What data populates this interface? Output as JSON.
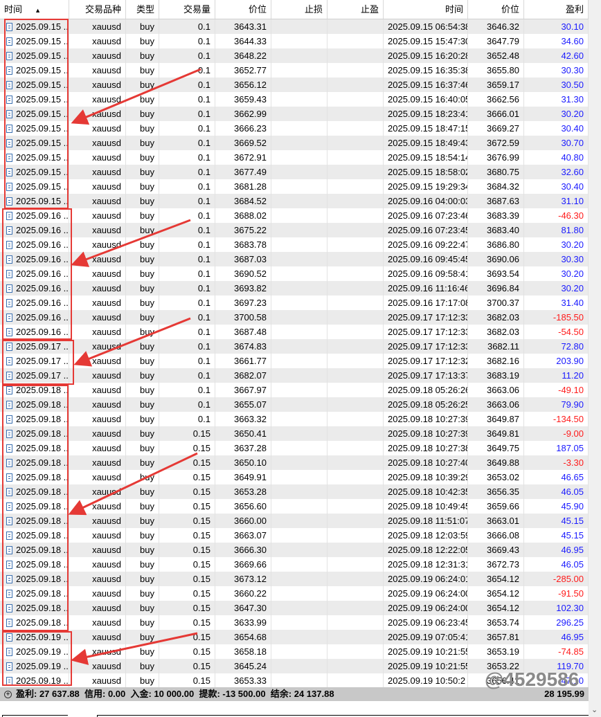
{
  "columns": [
    "时间",
    "交易品种",
    "类型",
    "交易量",
    "价位",
    "止损",
    "止盈",
    "时间",
    "价位",
    "盈利"
  ],
  "sort_indicator": "▲",
  "rows": [
    [
      "2025.09.15 ...",
      "xauusd",
      "buy",
      "0.1",
      "3643.31",
      "",
      "",
      "2025.09.15 06:54:38",
      "3646.32",
      "30.10"
    ],
    [
      "2025.09.15 ...",
      "xauusd",
      "buy",
      "0.1",
      "3644.33",
      "",
      "",
      "2025.09.15 15:47:30",
      "3647.79",
      "34.60"
    ],
    [
      "2025.09.15 ...",
      "xauusd",
      "buy",
      "0.1",
      "3648.22",
      "",
      "",
      "2025.09.15 16:20:28",
      "3652.48",
      "42.60"
    ],
    [
      "2025.09.15 ...",
      "xauusd",
      "buy",
      "0.1",
      "3652.77",
      "",
      "",
      "2025.09.15 16:35:38",
      "3655.80",
      "30.30"
    ],
    [
      "2025.09.15 ...",
      "xauusd",
      "buy",
      "0.1",
      "3656.12",
      "",
      "",
      "2025.09.15 16:37:46",
      "3659.17",
      "30.50"
    ],
    [
      "2025.09.15 ...",
      "xauusd",
      "buy",
      "0.1",
      "3659.43",
      "",
      "",
      "2025.09.15 16:40:05",
      "3662.56",
      "31.30"
    ],
    [
      "2025.09.15 ...",
      "xauusd",
      "buy",
      "0.1",
      "3662.99",
      "",
      "",
      "2025.09.15 18:23:41",
      "3666.01",
      "30.20"
    ],
    [
      "2025.09.15 ...",
      "xauusd",
      "buy",
      "0.1",
      "3666.23",
      "",
      "",
      "2025.09.15 18:47:15",
      "3669.27",
      "30.40"
    ],
    [
      "2025.09.15 ...",
      "xauusd",
      "buy",
      "0.1",
      "3669.52",
      "",
      "",
      "2025.09.15 18:49:43",
      "3672.59",
      "30.70"
    ],
    [
      "2025.09.15 ...",
      "xauusd",
      "buy",
      "0.1",
      "3672.91",
      "",
      "",
      "2025.09.15 18:54:14",
      "3676.99",
      "40.80"
    ],
    [
      "2025.09.15 ...",
      "xauusd",
      "buy",
      "0.1",
      "3677.49",
      "",
      "",
      "2025.09.15 18:58:02",
      "3680.75",
      "32.60"
    ],
    [
      "2025.09.15 ...",
      "xauusd",
      "buy",
      "0.1",
      "3681.28",
      "",
      "",
      "2025.09.15 19:29:34",
      "3684.32",
      "30.40"
    ],
    [
      "2025.09.15 ...",
      "xauusd",
      "buy",
      "0.1",
      "3684.52",
      "",
      "",
      "2025.09.16 04:00:03",
      "3687.63",
      "31.10"
    ],
    [
      "2025.09.16 ...",
      "xauusd",
      "buy",
      "0.1",
      "3688.02",
      "",
      "",
      "2025.09.16 07:23:46",
      "3683.39",
      "-46.30"
    ],
    [
      "2025.09.16 ...",
      "xauusd",
      "buy",
      "0.1",
      "3675.22",
      "",
      "",
      "2025.09.16 07:23:45",
      "3683.40",
      "81.80"
    ],
    [
      "2025.09.16 ...",
      "xauusd",
      "buy",
      "0.1",
      "3683.78",
      "",
      "",
      "2025.09.16 09:22:47",
      "3686.80",
      "30.20"
    ],
    [
      "2025.09.16 ...",
      "xauusd",
      "buy",
      "0.1",
      "3687.03",
      "",
      "",
      "2025.09.16 09:45:45",
      "3690.06",
      "30.30"
    ],
    [
      "2025.09.16 ...",
      "xauusd",
      "buy",
      "0.1",
      "3690.52",
      "",
      "",
      "2025.09.16 09:58:41",
      "3693.54",
      "30.20"
    ],
    [
      "2025.09.16 ...",
      "xauusd",
      "buy",
      "0.1",
      "3693.82",
      "",
      "",
      "2025.09.16 11:16:46",
      "3696.84",
      "30.20"
    ],
    [
      "2025.09.16 ...",
      "xauusd",
      "buy",
      "0.1",
      "3697.23",
      "",
      "",
      "2025.09.16 17:17:08",
      "3700.37",
      "31.40"
    ],
    [
      "2025.09.16 ...",
      "xauusd",
      "buy",
      "0.1",
      "3700.58",
      "",
      "",
      "2025.09.17 17:12:33",
      "3682.03",
      "-185.50"
    ],
    [
      "2025.09.16 ...",
      "xauusd",
      "buy",
      "0.1",
      "3687.48",
      "",
      "",
      "2025.09.17 17:12:33",
      "3682.03",
      "-54.50"
    ],
    [
      "2025.09.17 ...",
      "xauusd",
      "buy",
      "0.1",
      "3674.83",
      "",
      "",
      "2025.09.17 17:12:33",
      "3682.11",
      "72.80"
    ],
    [
      "2025.09.17 ...",
      "xauusd",
      "buy",
      "0.1",
      "3661.77",
      "",
      "",
      "2025.09.17 17:12:32",
      "3682.16",
      "203.90"
    ],
    [
      "2025.09.17 ...",
      "xauusd",
      "buy",
      "0.1",
      "3682.07",
      "",
      "",
      "2025.09.17 17:13:37",
      "3683.19",
      "11.20"
    ],
    [
      "2025.09.18 ...",
      "xauusd",
      "buy",
      "0.1",
      "3667.97",
      "",
      "",
      "2025.09.18 05:26:26",
      "3663.06",
      "-49.10"
    ],
    [
      "2025.09.18 ...",
      "xauusd",
      "buy",
      "0.1",
      "3655.07",
      "",
      "",
      "2025.09.18 05:26:25",
      "3663.06",
      "79.90"
    ],
    [
      "2025.09.18 ...",
      "xauusd",
      "buy",
      "0.1",
      "3663.32",
      "",
      "",
      "2025.09.18 10:27:39",
      "3649.87",
      "-134.50"
    ],
    [
      "2025.09.18 ...",
      "xauusd",
      "buy",
      "0.15",
      "3650.41",
      "",
      "",
      "2025.09.18 10:27:39",
      "3649.81",
      "-9.00"
    ],
    [
      "2025.09.18 ...",
      "xauusd",
      "buy",
      "0.15",
      "3637.28",
      "",
      "",
      "2025.09.18 10:27:38",
      "3649.75",
      "187.05"
    ],
    [
      "2025.09.18 ...",
      "xauusd",
      "buy",
      "0.15",
      "3650.10",
      "",
      "",
      "2025.09.18 10:27:40",
      "3649.88",
      "-3.30"
    ],
    [
      "2025.09.18 ...",
      "xauusd",
      "buy",
      "0.15",
      "3649.91",
      "",
      "",
      "2025.09.18 10:39:29",
      "3653.02",
      "46.65"
    ],
    [
      "2025.09.18 ...",
      "xauusd",
      "buy",
      "0.15",
      "3653.28",
      "",
      "",
      "2025.09.18 10:42:35",
      "3656.35",
      "46.05"
    ],
    [
      "2025.09.18 ...",
      "xauusd",
      "buy",
      "0.15",
      "3656.60",
      "",
      "",
      "2025.09.18 10:49:45",
      "3659.66",
      "45.90"
    ],
    [
      "2025.09.18 ...",
      "xauusd",
      "buy",
      "0.15",
      "3660.00",
      "",
      "",
      "2025.09.18 11:51:07",
      "3663.01",
      "45.15"
    ],
    [
      "2025.09.18 ...",
      "xauusd",
      "buy",
      "0.15",
      "3663.07",
      "",
      "",
      "2025.09.18 12:03:59",
      "3666.08",
      "45.15"
    ],
    [
      "2025.09.18 ...",
      "xauusd",
      "buy",
      "0.15",
      "3666.30",
      "",
      "",
      "2025.09.18 12:22:05",
      "3669.43",
      "46.95"
    ],
    [
      "2025.09.18 ...",
      "xauusd",
      "buy",
      "0.15",
      "3669.66",
      "",
      "",
      "2025.09.18 12:31:31",
      "3672.73",
      "46.05"
    ],
    [
      "2025.09.18 ...",
      "xauusd",
      "buy",
      "0.15",
      "3673.12",
      "",
      "",
      "2025.09.19 06:24:01",
      "3654.12",
      "-285.00"
    ],
    [
      "2025.09.18 ...",
      "xauusd",
      "buy",
      "0.15",
      "3660.22",
      "",
      "",
      "2025.09.19 06:24:00",
      "3654.12",
      "-91.50"
    ],
    [
      "2025.09.18 ...",
      "xauusd",
      "buy",
      "0.15",
      "3647.30",
      "",
      "",
      "2025.09.19 06:24:00",
      "3654.12",
      "102.30"
    ],
    [
      "2025.09.18 ...",
      "xauusd",
      "buy",
      "0.15",
      "3633.99",
      "",
      "",
      "2025.09.19 06:23:45",
      "3653.74",
      "296.25"
    ],
    [
      "2025.09.19 ...",
      "xauusd",
      "buy",
      "0.15",
      "3654.68",
      "",
      "",
      "2025.09.19 07:05:41",
      "3657.81",
      "46.95"
    ],
    [
      "2025.09.19 ...",
      "xauusd",
      "buy",
      "0.15",
      "3658.18",
      "",
      "",
      "2025.09.19 10:21:55",
      "3653.19",
      "-74.85"
    ],
    [
      "2025.09.19 ...",
      "xauusd",
      "buy",
      "0.15",
      "3645.24",
      "",
      "",
      "2025.09.19 10:21:55",
      "3653.22",
      "119.70"
    ],
    [
      "2025.09.19 ...",
      "xauusd",
      "buy",
      "0.15",
      "3653.33",
      "",
      "",
      "2025.09.19 10:50:2",
      "3656.41",
      "47.10"
    ]
  ],
  "footer": {
    "summary": "盈利: 27 637.88  信用: 0.00  入金: 10 000.00  提款: -13 500.00  结余: 24 137.88",
    "total": "28 195.99"
  },
  "watermark": "@4529586",
  "colors": {
    "positive": "#1a1aff",
    "negative": "#ff1a1a",
    "annotation": "#e53935"
  }
}
